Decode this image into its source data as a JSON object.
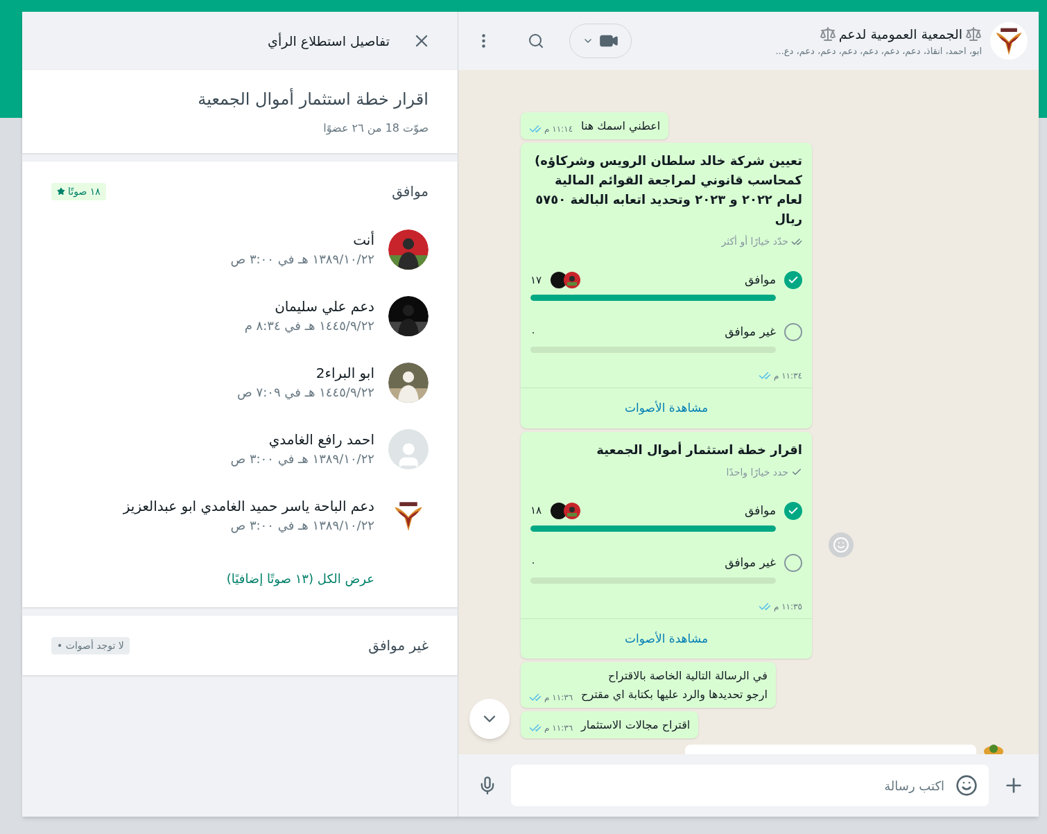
{
  "chat": {
    "title": "الجمعية العمومية لدعم",
    "subtitle": "ابو، احمد، انقاذ، دعم، دعم، دعم، دعم، دعم، دعم، دع...",
    "messages": [
      {
        "kind": "text",
        "lines": [
          "اعطني اسمك هنا"
        ],
        "time": "١١:١٤ م",
        "read": true
      },
      {
        "kind": "poll",
        "question": "تعيين شركة خالد سلطان الرويس وشركاؤه) كمحاسب قانوني لمراجعة القوائم المالية لعام ٢٠٢٢ و ٢٠٢٣ وتحديد اتعابه البالغة ٥٧٥٠ ريال",
        "hint": "حدّد خيارًا أو أكثر",
        "multiple": true,
        "options": [
          {
            "label": "موافق",
            "checked": true,
            "level": 1,
            "count": "١٧",
            "has_avatars": true
          },
          {
            "label": "غير موافق",
            "checked": false,
            "level": 0,
            "count": "٠",
            "has_avatars": false
          }
        ],
        "time": "١١:٣٤ م",
        "read": true,
        "action": "مشاهدة الأصوات",
        "reaction_button": false
      },
      {
        "kind": "poll",
        "question": "اقرار خطة استثمار أموال الجمعية",
        "hint": "حدد خيارًا واحدًا",
        "multiple": false,
        "options": [
          {
            "label": "موافق",
            "checked": true,
            "level": 1,
            "count": "١٨",
            "has_avatars": true
          },
          {
            "label": "غير موافق",
            "checked": false,
            "level": 0,
            "count": "٠",
            "has_avatars": false
          }
        ],
        "time": "١١:٣٥ م",
        "read": true,
        "action": "مشاهدة الأصوات",
        "reaction_button": true
      },
      {
        "kind": "text",
        "lines": [
          "في الرسالة التالية الخاصة بالاقتراح",
          "ارجو تحديدها والرد عليها بكتابة اي مقترح"
        ],
        "time": "١١:٣٦ م",
        "read": true
      },
      {
        "kind": "text",
        "lines": [
          "اقتراح مجالات الاستثمار"
        ],
        "time": "١١:٣٦ م",
        "read": true
      },
      {
        "kind": "incoming"
      }
    ],
    "composer": {
      "placeholder": "اكتب رسالة"
    }
  },
  "details": {
    "title": "تفاصيل استطلاع الرأي",
    "question": "اقرار خطة استثمار أموال الجمعية",
    "summary": "صوّت 18 من ٢٦ عضوًا",
    "options": [
      {
        "label": "موافق",
        "badge": "١٨ صوتًا",
        "winner": true,
        "voters": [
          {
            "name": "أنت",
            "time": "١٣٨٩/١٠/٢٢ هـ في ٣:٠٠ ص",
            "kind": "photo_red"
          },
          {
            "name": "دعم علي سليمان",
            "time": "١٤٤٥/٩/٢٢ هـ في ٨:٣٤ م",
            "kind": "dark"
          },
          {
            "name": "ابو البراء2",
            "time": "١٤٤٥/٩/٢٢ هـ في ٧:٠٩ ص",
            "kind": "photo_man"
          },
          {
            "name": "احمد رافع الغامدي",
            "time": "١٣٨٩/١٠/٢٢ هـ في ٣:٠٠ ص",
            "kind": "default"
          },
          {
            "name": "دعم الباحة ياسر حميد الغامدي ابو عبدالعزيز",
            "time": "١٣٨٩/١٠/٢٢ هـ في ٣:٠٠ ص",
            "kind": "logo"
          }
        ],
        "more": "عرض الكل (١٣ صوتًا إضافيًا)"
      },
      {
        "label": "غير موافق",
        "badge": "لا توجد أصوات •",
        "winner": false
      }
    ]
  }
}
